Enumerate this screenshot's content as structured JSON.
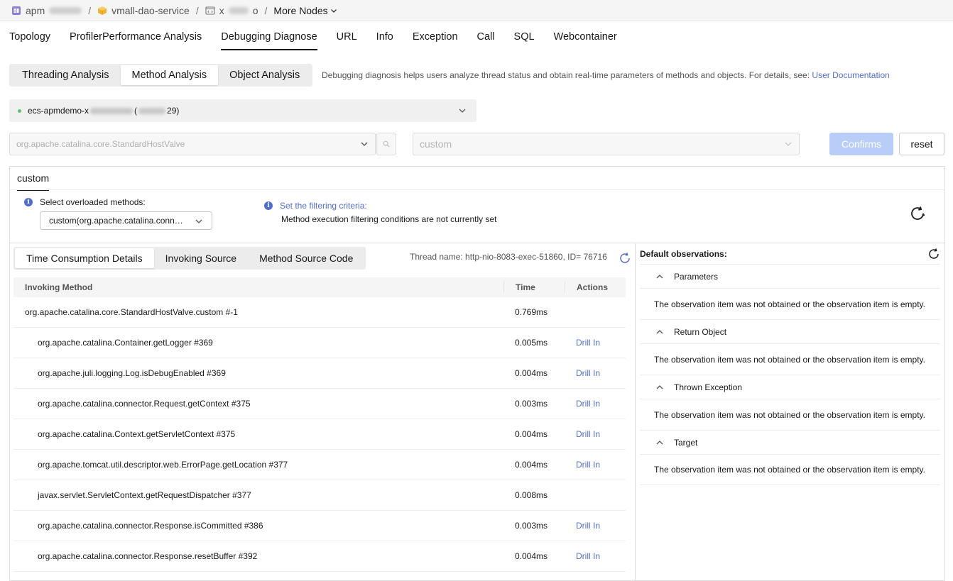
{
  "breadcrumb": {
    "app": "apm",
    "service": "vmall-dao-service",
    "env_prefix": "x",
    "env_suffix": "o",
    "more": "More Nodes"
  },
  "main_tabs": [
    "Topology",
    "ProfilerPerformance Analysis",
    "Debugging Diagnose",
    "URL",
    "Info",
    "Exception",
    "Call",
    "SQL",
    "Webcontainer"
  ],
  "active_main_tab": "Debugging Diagnose",
  "sub_tabs": [
    "Threading Analysis",
    "Method Analysis",
    "Object Analysis"
  ],
  "active_sub_tab": "Method Analysis",
  "description": "Debugging diagnosis helps users analyze thread status and obtain real-time parameters of methods and objects. For details, see:",
  "doc_link": "User Documentation",
  "instance": {
    "prefix": "ecs-apmdemo-x",
    "suffix": "29)",
    "status_color": "#5cc46b"
  },
  "class_select": {
    "value": "org.apache.catalina.core.StandardHostValve"
  },
  "method_select": {
    "value": "custom"
  },
  "buttons": {
    "confirm": "Confirms",
    "reset": "reset"
  },
  "custom_panel": {
    "tab": "custom",
    "overloaded_label": "Select overloaded methods:",
    "overloaded_value": "custom(org.apache.catalina.conn…",
    "filter_title": "Set the filtering criteria:",
    "filter_text": "Method execution filtering conditions are not currently set"
  },
  "left_panel": {
    "tabs": [
      "Time Consumption Details",
      "Invoking Source",
      "Method Source Code"
    ],
    "active_tab": "Time Consumption Details",
    "thread_name": "Thread name: http-nio-8083-exec-51860, ID= 76716",
    "columns": {
      "method": "Invoking Method",
      "time": "Time",
      "actions": "Actions"
    },
    "rows": [
      {
        "method": "org.apache.catalina.core.StandardHostValve.custom #-1",
        "time": "0.769ms",
        "action": "",
        "level": 0
      },
      {
        "method": "org.apache.catalina.Container.getLogger #369",
        "time": "0.005ms",
        "action": "Drill In",
        "level": 1
      },
      {
        "method": "org.apache.juli.logging.Log.isDebugEnabled #369",
        "time": "0.004ms",
        "action": "Drill In",
        "level": 1
      },
      {
        "method": "org.apache.catalina.connector.Request.getContext #375",
        "time": "0.003ms",
        "action": "Drill In",
        "level": 1
      },
      {
        "method": "org.apache.catalina.Context.getServletContext #375",
        "time": "0.004ms",
        "action": "Drill In",
        "level": 1
      },
      {
        "method": "org.apache.tomcat.util.descriptor.web.ErrorPage.getLocation #377",
        "time": "0.004ms",
        "action": "Drill In",
        "level": 1
      },
      {
        "method": "javax.servlet.ServletContext.getRequestDispatcher #377",
        "time": "0.008ms",
        "action": "",
        "level": 1
      },
      {
        "method": "org.apache.catalina.connector.Response.isCommitted #386",
        "time": "0.003ms",
        "action": "Drill In",
        "level": 1
      },
      {
        "method": "org.apache.catalina.connector.Response.resetBuffer #392",
        "time": "0.004ms",
        "action": "Drill In",
        "level": 1
      }
    ]
  },
  "right_panel": {
    "title": "Default observations:",
    "sections": [
      {
        "name": "Parameters",
        "message": "The observation item was not obtained or the observation item is empty."
      },
      {
        "name": "Return Object",
        "message": "The observation item was not obtained or the observation item is empty."
      },
      {
        "name": "Thrown Exception",
        "message": "The observation item was not obtained or the observation item is empty."
      },
      {
        "name": "Target",
        "message": "The observation item was not obtained or the observation item is empty."
      }
    ]
  }
}
